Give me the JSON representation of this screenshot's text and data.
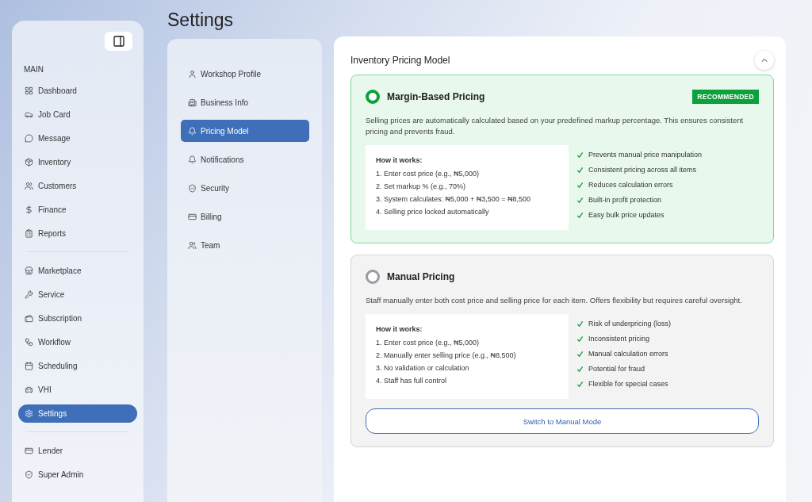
{
  "page_title": "Settings",
  "sidebar": {
    "section_label": "MAIN",
    "groups": [
      [
        {
          "label": "Dashboard",
          "kind": "grid",
          "selected": false
        },
        {
          "label": "Job Card",
          "kind": "car",
          "selected": false
        },
        {
          "label": "Message",
          "kind": "message",
          "selected": false
        },
        {
          "label": "Inventory",
          "kind": "box",
          "selected": false
        },
        {
          "label": "Customers",
          "kind": "users",
          "selected": false
        },
        {
          "label": "Finance",
          "kind": "dollar",
          "selected": false
        },
        {
          "label": "Reports",
          "kind": "clipboard",
          "selected": false
        }
      ],
      [
        {
          "label": "Marketplace",
          "kind": "store",
          "selected": false
        },
        {
          "label": "Service",
          "kind": "wrench",
          "selected": false
        },
        {
          "label": "Subscription",
          "kind": "tickets",
          "selected": false
        },
        {
          "label": "Workflow",
          "kind": "workflow",
          "selected": false
        },
        {
          "label": "Scheduling",
          "kind": "calendar",
          "selected": false
        },
        {
          "label": "VHI",
          "kind": "carfront",
          "selected": false
        },
        {
          "label": "Settings",
          "kind": "gear",
          "selected": true
        }
      ],
      [
        {
          "label": "Lender",
          "kind": "card",
          "selected": false
        },
        {
          "label": "Super Admin",
          "kind": "shield",
          "selected": false
        }
      ]
    ]
  },
  "settings_nav": [
    {
      "label": "Workshop Profile",
      "kind": "user",
      "selected": false
    },
    {
      "label": "Business Info",
      "kind": "building",
      "selected": false
    },
    {
      "label": "Pricing Model",
      "kind": "bell",
      "selected": true
    },
    {
      "label": "Notifications",
      "kind": "bell",
      "selected": false
    },
    {
      "label": "Security",
      "kind": "shield",
      "selected": false
    },
    {
      "label": "Billing",
      "kind": "card",
      "selected": false
    },
    {
      "label": "Team",
      "kind": "users",
      "selected": false
    }
  ],
  "section": {
    "title": "Inventory Pricing Model",
    "expanded": true,
    "options": [
      {
        "title": "Margin-Based Pricing",
        "selected": true,
        "badge": "RECOMMENDED",
        "description": "Selling prices are automatically calculated based on your predefined markup percentage. This ensures consistent pricing and prevents fraud.",
        "how_title": "How it works:",
        "steps": [
          "1. Enter cost price (e.g., ₦5,000)",
          "2. Set markup % (e.g., 70%)",
          "3. System calculates: ₦5,000 + ₦3,500 = ₦8,500",
          "4. Selling price locked automatically"
        ],
        "points": [
          "Prevents manual price manipulation",
          "Consistent pricing across all items",
          "Reduces calculation errors",
          "Built-in profit protection",
          "Easy bulk price updates"
        ]
      },
      {
        "title": "Manual Pricing",
        "selected": false,
        "description": "Staff manually enter both cost price and selling price for each item. Offers flexibility but requires careful oversight.",
        "how_title": "How it works:",
        "steps": [
          "1. Enter cost price (e.g., ₦5,000)",
          "2. Manually enter selling price (e.g., ₦8,500)",
          "3. No validation or calculation",
          "4. Staff has full control"
        ],
        "points": [
          "Risk of underpricing (loss)",
          "Inconsistent pricing",
          "Manual calculation errors",
          "Potential for fraud",
          "Flexible for special cases"
        ],
        "button": "Switch to Manual Mode"
      }
    ]
  }
}
